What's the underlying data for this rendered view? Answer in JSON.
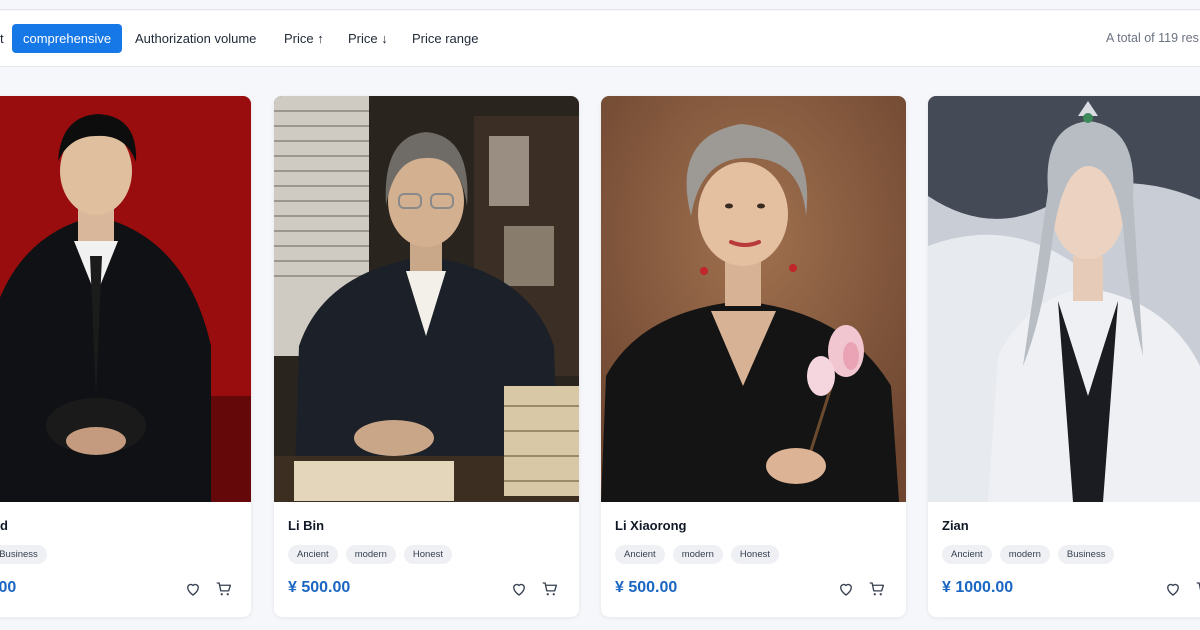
{
  "toolbar": {
    "sort_label": "t",
    "options": [
      "comprehensive",
      "Authorization volume",
      "Price ↑",
      "Price ↓",
      "Price range"
    ],
    "total_text": "A total of 119 res"
  },
  "colors": {
    "accent": "#1677e6",
    "price": "#1a66c2",
    "tag_bg": "#eef0f4"
  },
  "products": [
    {
      "name": "d",
      "tags": [
        "",
        "modern",
        "Business"
      ],
      "price": ".00"
    },
    {
      "name": "Li Bin",
      "tags": [
        "Ancient",
        "modern",
        "Honest"
      ],
      "price": "¥ 500.00"
    },
    {
      "name": "Li Xiaorong",
      "tags": [
        "Ancient",
        "modern",
        "Honest"
      ],
      "price": "¥ 500.00"
    },
    {
      "name": "Zian",
      "tags": [
        "Ancient",
        "modern",
        "Business"
      ],
      "price": "¥ 1000.00"
    }
  ],
  "icons": {
    "favorite": "heart-icon",
    "cart": "cart-icon"
  }
}
